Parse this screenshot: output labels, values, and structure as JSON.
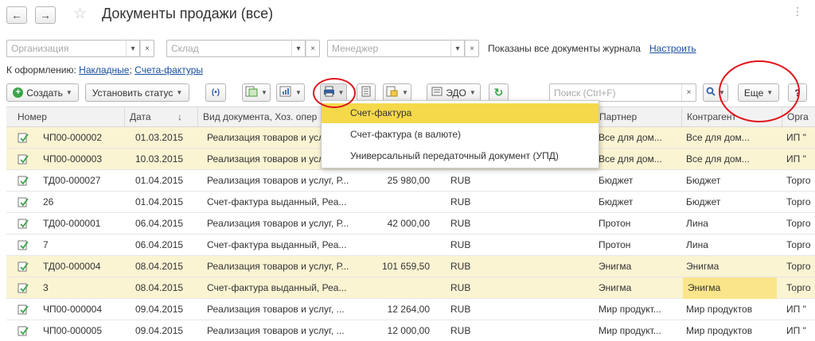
{
  "window": {
    "title": "Документы продажи (все)",
    "back_icon": "←",
    "forward_icon": "→",
    "more_icon": "⋮"
  },
  "filters": {
    "organization_placeholder": "Организация",
    "warehouse_placeholder": "Склад",
    "manager_placeholder": "Менеджер",
    "shown_text": "Показаны все документы журнала",
    "configure_link": "Настроить"
  },
  "draft": {
    "label": "К оформлению:",
    "link_invoices": "Накладные",
    "sep": ";",
    "link_facts": "Счета-фактуры"
  },
  "toolbar": {
    "create_label": "Создать",
    "set_status_label": "Установить статус",
    "edo_label": "ЭДО",
    "search_placeholder": "Поиск (Ctrl+F)",
    "more_label": "Еще",
    "help_label": "?"
  },
  "menu": {
    "items": [
      "Счет-фактура",
      "Счет-фактура (в валюте)",
      "Универсальный передаточный документ (УПД)"
    ]
  },
  "table": {
    "columns": [
      "Номер",
      "Дата",
      "Вид документа, Хоз. опер",
      "",
      "",
      "",
      "Партнер",
      "Контрагент",
      "Орга"
    ],
    "sort_icon": "↓",
    "rows": [
      {
        "number": "ЧП00-000002",
        "date": "01.03.2015",
        "type": "Реализация товаров и усл",
        "sum": "",
        "currency": "",
        "partner": "Все для дом...",
        "contractor": "Все для дом...",
        "org": "ИП \"",
        "yellow": true
      },
      {
        "number": "ЧП00-000003",
        "date": "10.03.2015",
        "type": "Реализация товаров и усл",
        "sum": "",
        "currency": "",
        "partner": "Все для дом...",
        "contractor": "Все для дом...",
        "org": "ИП \"",
        "yellow": true
      },
      {
        "number": "ТД00-000027",
        "date": "01.04.2015",
        "type": "Реализация товаров и услуг, Р...",
        "sum": "25 980,00",
        "currency": "RUB",
        "partner": "Бюджет",
        "contractor": "Бюджет",
        "org": "Торго",
        "yellow": false
      },
      {
        "number": "26",
        "date": "01.04.2015",
        "type": "Счет-фактура выданный, Реа...",
        "sum": "",
        "currency": "RUB",
        "partner": "Бюджет",
        "contractor": "Бюджет",
        "org": "Торго",
        "yellow": false
      },
      {
        "number": "ТД00-000001",
        "date": "06.04.2015",
        "type": "Реализация товаров и услуг, Р...",
        "sum": "42 000,00",
        "currency": "RUB",
        "partner": "Протон",
        "contractor": "Лина",
        "org": "Торго",
        "yellow": false
      },
      {
        "number": "7",
        "date": "06.04.2015",
        "type": "Счет-фактура выданный, Реа...",
        "sum": "",
        "currency": "RUB",
        "partner": "Протон",
        "contractor": "Лина",
        "org": "Торго",
        "yellow": false
      },
      {
        "number": "ТД00-000004",
        "date": "08.04.2015",
        "type": "Реализация товаров и услуг, Р...",
        "sum": "101 659,50",
        "currency": "RUB",
        "partner": "Энигма",
        "contractor": "Энигма",
        "org": "Торго",
        "yellow": true
      },
      {
        "number": "3",
        "date": "08.04.2015",
        "type": "Счет-фактура выданный, Реа...",
        "sum": "",
        "currency": "RUB",
        "partner": "Энигма",
        "contractor": "Энигма",
        "org": "Торго",
        "yellow": true,
        "highlight_contractor": true
      },
      {
        "number": "ЧП00-000004",
        "date": "09.04.2015",
        "type": "Реализация товаров и услуг, ...",
        "sum": "12 264,00",
        "currency": "RUB",
        "partner": "Мир продукт...",
        "contractor": "Мир продуктов",
        "org": "ИП \"",
        "yellow": false
      },
      {
        "number": "ЧП00-000005",
        "date": "09.04.2015",
        "type": "Реализация товаров и услуг, ...",
        "sum": "12 000,00",
        "currency": "RUB",
        "partner": "Мир продукт...",
        "contractor": "Мир продуктов",
        "org": "ИП \"",
        "yellow": false
      }
    ]
  },
  "colors": {
    "accent_link": "#1a4fa0",
    "row_yellow": "#fbf4d3",
    "menu_active": "#f5d94a",
    "annotation": "#e0141a",
    "refresh_green": "#3aa44a"
  }
}
